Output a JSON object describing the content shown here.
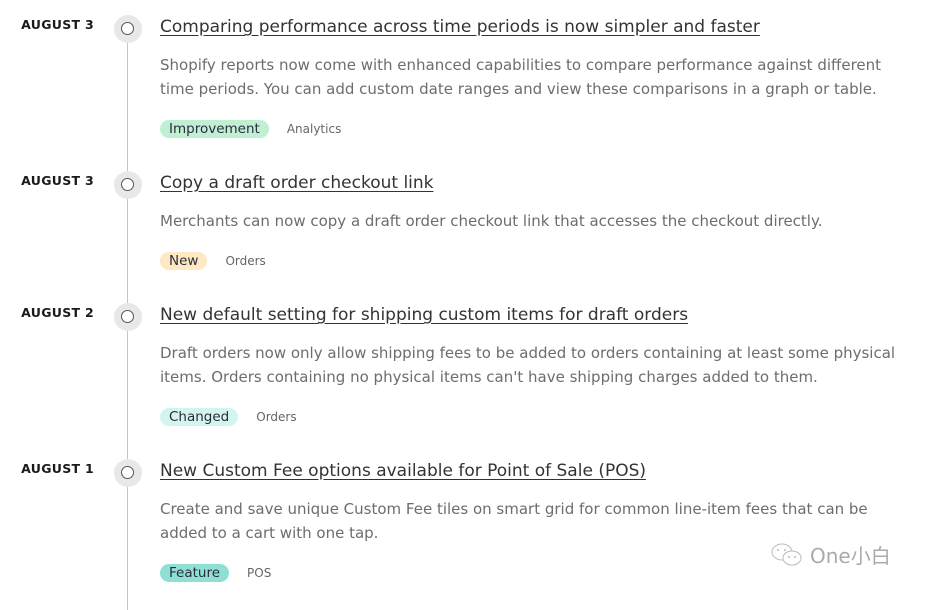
{
  "entries": [
    {
      "date": "AUGUST 3",
      "title": "Comparing performance across time periods is now simpler and faster",
      "description": "Shopify reports now come with enhanced capabilities to compare performance against different time periods. You can add custom date ranges and view these comparisons in a graph or table.",
      "badge": "Improvement",
      "badge_color": "#c1efd4",
      "category": "Analytics"
    },
    {
      "date": "AUGUST 3",
      "title": "Copy a draft order checkout link",
      "description": "Merchants can now copy a draft order checkout link that accesses the checkout directly.",
      "badge": "New",
      "badge_color": "#fde9c4",
      "category": "Orders"
    },
    {
      "date": "AUGUST 2",
      "title": "New default setting for shipping custom items for draft orders",
      "description": "Draft orders now only allow shipping fees to be added to orders containing at least some physical items. Orders containing no physical items can't have shipping charges added to them.",
      "badge": "Changed",
      "badge_color": "#d3f5f0",
      "category": "Orders"
    },
    {
      "date": "AUGUST 1",
      "title": "New Custom Fee options available for Point of Sale (POS)",
      "description": "Create and save unique Custom Fee tiles on smart grid for common line-item fees that can be added to a cart with one tap.",
      "badge": "Feature",
      "badge_color": "#8fe0d4",
      "category": "POS"
    }
  ],
  "watermark": "One小白"
}
